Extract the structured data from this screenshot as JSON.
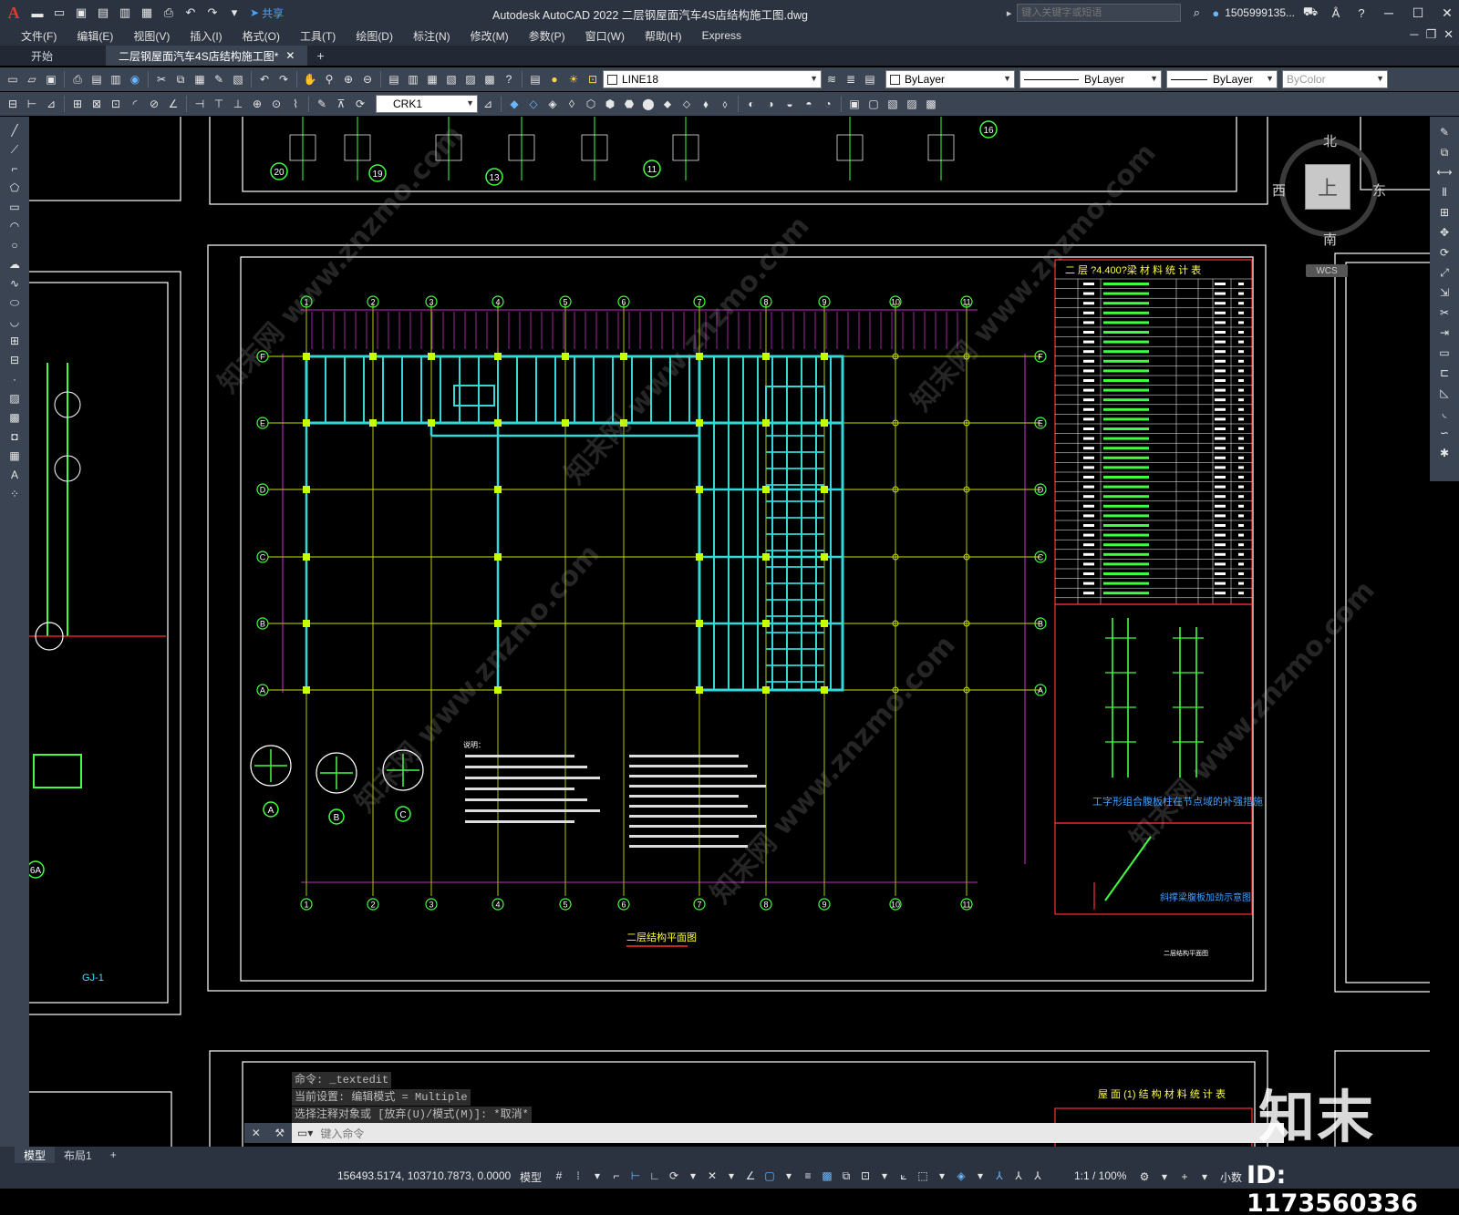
{
  "title_bar": {
    "app_logo": "A",
    "share_label": "共享",
    "title": "Autodesk AutoCAD 2022    二层钢屋面汽车4S店结构施工图.dwg",
    "search_placeholder": "键入关键字或短语",
    "user": "1505999135..."
  },
  "menu": {
    "items": [
      "文件(F)",
      "编辑(E)",
      "视图(V)",
      "插入(I)",
      "格式(O)",
      "工具(T)",
      "绘图(D)",
      "标注(N)",
      "修改(M)",
      "参数(P)",
      "窗口(W)",
      "帮助(H)",
      "Express"
    ]
  },
  "doc_tabs": {
    "start": "开始",
    "active": "二层钢屋面汽车4S店结构施工图*"
  },
  "toolbar": {
    "layer": "LINE18",
    "color": "ByLayer",
    "linetype": "ByLayer",
    "lineweight": "ByLayer",
    "plotstyle": "ByColor",
    "text_style": "CRK1"
  },
  "viewcube": {
    "north": "北",
    "south": "南",
    "east": "东",
    "west": "西",
    "top": "上",
    "wcs": "WCS"
  },
  "drawing": {
    "main_title": "二层结构平面图",
    "table1_title": "二 层 ?4.400?梁  材 料 统 计 表",
    "table2_title": "屋 面 (1) 结 构 材 料 统 计 表",
    "detail_title": "工字形组合腹板柱在节点域的补强措施",
    "section_title": "斜撑梁腹板加劲示意图",
    "notes_heading": "说明：",
    "left_label": "GJ-1",
    "sheet_label": "二层结构平面图",
    "circle_labels": [
      "A",
      "B",
      "C"
    ],
    "detail_numbers": [
      "20",
      "19",
      "13",
      "11",
      "16",
      "6A"
    ],
    "axis_numbers": [
      "1",
      "2",
      "3",
      "4",
      "5",
      "6",
      "7",
      "8",
      "9",
      "10",
      "11"
    ],
    "axis_letters": [
      "F",
      "E",
      "D",
      "C",
      "B",
      "A"
    ]
  },
  "command": {
    "history": [
      "命令: _textedit",
      "当前设置: 编辑模式 = Multiple",
      "选择注释对象或 [放弃(U)/模式(M)]: *取消*"
    ],
    "prompt": "键入命令"
  },
  "layout_tabs": [
    "模型",
    "布局1"
  ],
  "status": {
    "coords": "156493.5174, 103710.7873, 0.0000",
    "model": "模型",
    "scale": "1:1 / 100%",
    "units": "小数"
  },
  "watermark": {
    "logo": "知末",
    "id": "ID: 1173560336",
    "site": "知末网 www.znzmo.com"
  }
}
